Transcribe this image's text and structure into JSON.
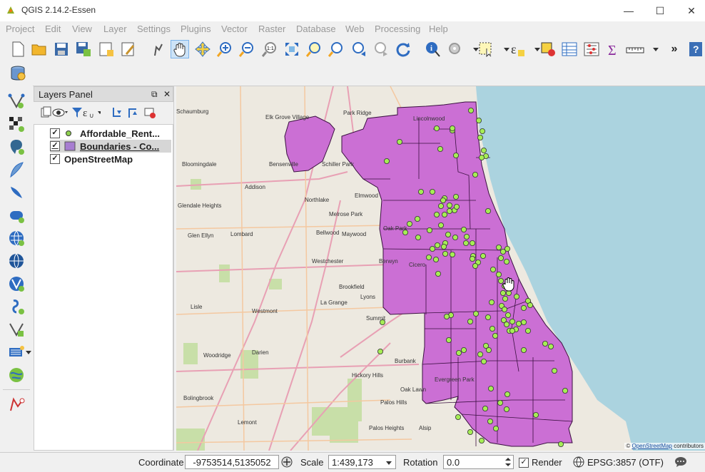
{
  "window": {
    "title": "QGIS 2.14.2-Essen",
    "minimize": "—",
    "maximize": "☐",
    "close": "✕"
  },
  "menu": [
    "Project",
    "Edit",
    "View",
    "Layer",
    "Settings",
    "Plugins",
    "Vector",
    "Raster",
    "Database",
    "Web",
    "Processing",
    "Help"
  ],
  "toolbar": {
    "overflow": "»",
    "help": "?"
  },
  "layers_panel": {
    "title": "Layers Panel",
    "float_icon": "⧉",
    "close_icon": "✕",
    "layers": [
      {
        "name": "Affordable_Rent...",
        "checked": true,
        "symbol": "point",
        "color": "#8fd14f"
      },
      {
        "name": "Boundaries - Co...",
        "checked": true,
        "symbol": "polygon",
        "color": "#a77dd1",
        "selected": true
      },
      {
        "name": "OpenStreetMap",
        "checked": true,
        "symbol": "none"
      }
    ]
  },
  "map": {
    "places": [
      "Schaumburg",
      "Elk Grove Village",
      "Park Ridge",
      "Lincolnwood",
      "Bloomingdale",
      "Bensenville",
      "Schiller Park",
      "Addison",
      "Elmwood",
      "Northlake",
      "Glendale Heights",
      "Melrose Park",
      "Oak Park",
      "Glen Ellyn",
      "Lombard",
      "Bellwood",
      "Maywood",
      "Westchester",
      "Berwyn",
      "Cicero",
      "Brookfield",
      "Lyons",
      "Lisle",
      "Westmont",
      "La Grange",
      "Summit",
      "Woodridge",
      "Darien",
      "Burbank",
      "Hickory Hills",
      "Oak Lawn",
      "Evergreen Park",
      "Bolingbrook",
      "Lemont",
      "Palos Hills",
      "Palos Heights",
      "Alsip"
    ],
    "attribution_link": "OpenStreetMap",
    "attribution_rest": " contributors",
    "polygon_color": "#cb6fd4",
    "point_color": "#a6ed55"
  },
  "status": {
    "coordinate_label": "Coordinate",
    "coordinate_value": "-9753514,5135052",
    "scale_label": "Scale",
    "scale_value": "1:439,173",
    "rotation_label": "Rotation",
    "rotation_value": "0.0",
    "render_label": "Render",
    "render_checked": true,
    "crs": "EPSG:3857 (OTF)"
  }
}
